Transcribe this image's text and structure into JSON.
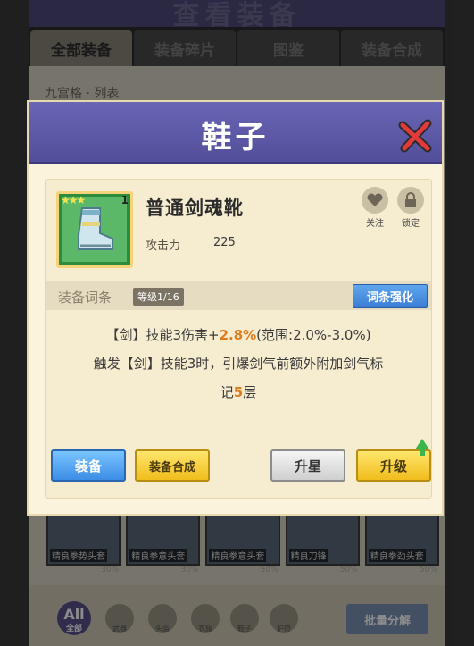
{
  "background": {
    "title": "查看装备",
    "tabs": [
      "全部装备",
      "装备碎片",
      "图鉴",
      "装备合成"
    ],
    "filter_text": "九宫格 · 列表",
    "grid_items": [
      {
        "name": "精良拳势头套",
        "pct": "30%"
      },
      {
        "name": "精良拳意头套",
        "pct": "30%"
      },
      {
        "name": "精良拳意头套",
        "pct": "50%"
      },
      {
        "name": "精良刀锋",
        "pct": "50%"
      },
      {
        "name": "精良拳劲头套",
        "pct": "50%"
      }
    ],
    "all_label": "All",
    "all_sub": "全部",
    "slots": [
      "武器",
      "头盔",
      "衣服",
      "鞋子",
      "护符"
    ],
    "decompose_label": "批量分解"
  },
  "modal": {
    "title": "鞋子",
    "item": {
      "name": "普通剑魂靴",
      "stars": "★★★",
      "count": "1",
      "stat_label": "攻击力",
      "stat_value": "225"
    },
    "follow_label": "关注",
    "lock_label": "锁定",
    "affix_label": "装备词条",
    "level_badge": "等级1/16",
    "enhance_label": "词条强化",
    "effect": {
      "line1_prefix": "【剑】技能3伤害+",
      "line1_value": "2.8%",
      "line1_suffix": "(范围:2.0%-3.0%)",
      "line2": "触发【剑】技能3时，引爆剑气前额外附加剑气标",
      "line3_prefix": "记",
      "line3_value": "5",
      "line3_suffix": "层"
    },
    "buttons": {
      "equip": "装备",
      "combine": "装备合成",
      "star_up": "升星",
      "upgrade": "升级"
    }
  }
}
